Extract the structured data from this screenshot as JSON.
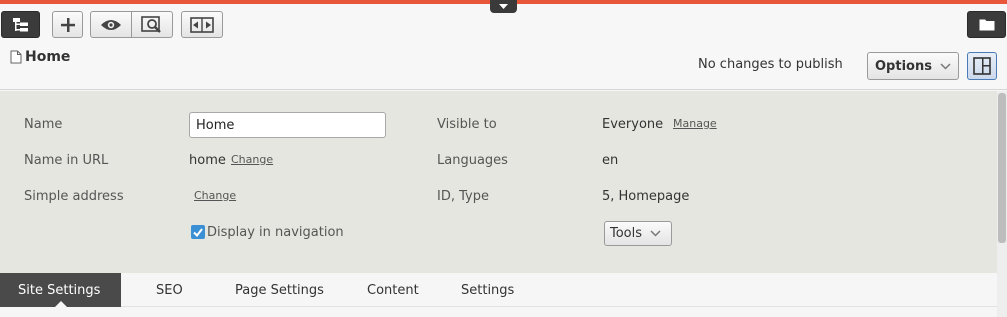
{
  "header": {
    "page_title": "Home",
    "publish_status": "No changes to publish",
    "options_label": "Options"
  },
  "properties": {
    "name_label": "Name",
    "name_value": "Home",
    "name_in_url_label": "Name in URL",
    "name_in_url_value": "home",
    "name_in_url_change": "Change",
    "simple_address_label": "Simple address",
    "simple_address_change": "Change",
    "display_in_nav_label": "Display in navigation",
    "display_in_nav_checked": true,
    "visible_to_label": "Visible to",
    "visible_to_value": "Everyone",
    "visible_to_manage": "Manage",
    "languages_label": "Languages",
    "languages_value": "en",
    "id_type_label": "ID, Type",
    "id_type_value": "5, Homepage",
    "tools_label": "Tools"
  },
  "tabs": [
    {
      "label": "Site Settings",
      "active": true
    },
    {
      "label": "SEO",
      "active": false
    },
    {
      "label": "Page Settings",
      "active": false
    },
    {
      "label": "Content",
      "active": false
    },
    {
      "label": "Settings",
      "active": false
    }
  ],
  "colors": {
    "accent": "#e8573a",
    "checkbox": "#3b8fd4",
    "active_tab": "#4a4a4a",
    "properties_bg": "#e6e6e0"
  },
  "icons": {
    "toolbar": [
      "page-tree-icon",
      "add-icon",
      "view-icon",
      "preview-icon",
      "compare-icon",
      "folder-icon"
    ],
    "dropdown_handle": "chevron-down-icon",
    "page": "page-icon",
    "layout": "layout-panel-icon"
  }
}
